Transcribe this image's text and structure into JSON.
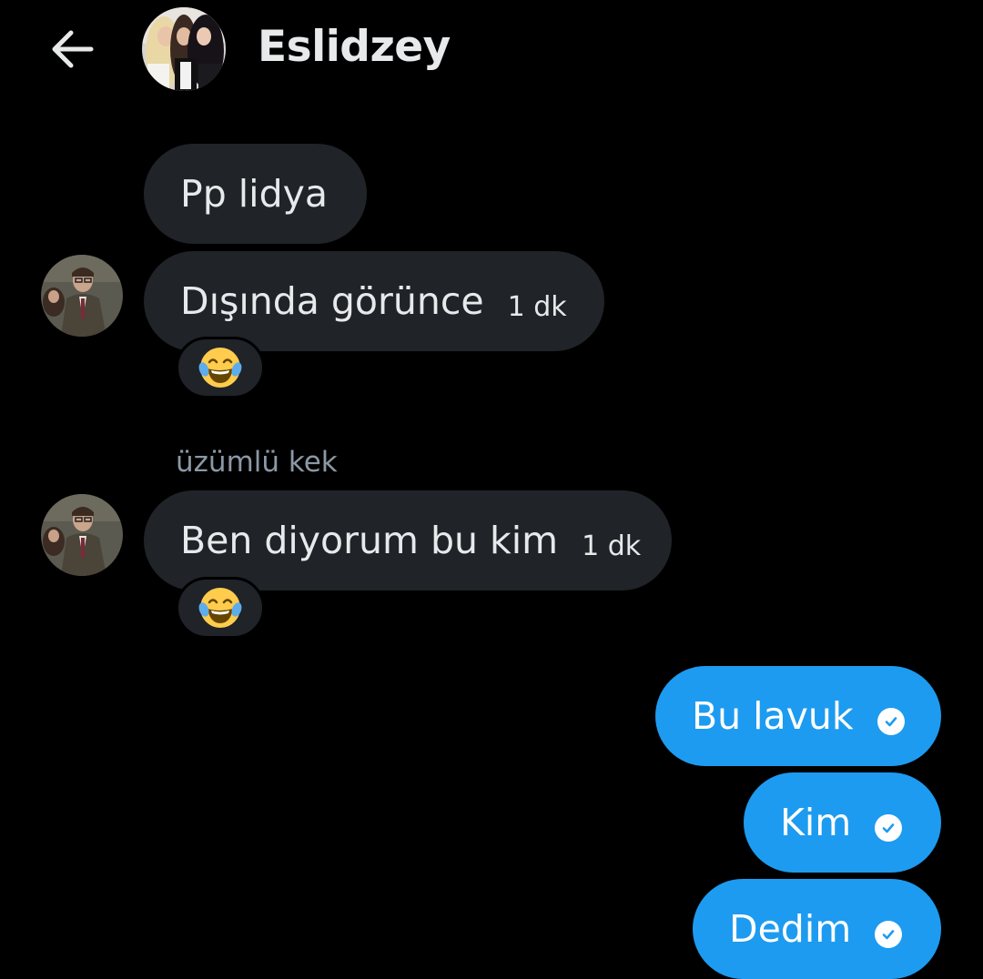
{
  "header": {
    "title": "Eslidzey",
    "back_icon": "arrow-left-icon",
    "avatar": "group-avatar"
  },
  "messages": [
    {
      "text": "Pp lidya",
      "time": ""
    },
    {
      "text": "Dışında görünce",
      "time": "1 dk",
      "reaction": "😂"
    },
    {
      "sender": "üzümlü kek",
      "text": "Ben diyorum bu kim",
      "time": "1 dk",
      "reaction": "😂"
    }
  ],
  "outgoing": [
    {
      "text": "Bu lavuk",
      "status": "check-circle-icon"
    },
    {
      "text": "Kim",
      "status": "check-circle-icon"
    },
    {
      "text": "Dedim",
      "status": "check-circle-icon"
    }
  ],
  "colors": {
    "background": "#000000",
    "incoming_bubble": "#202327",
    "outgoing_bubble": "#1d9bf0",
    "sender_name": "#8b98a5"
  }
}
